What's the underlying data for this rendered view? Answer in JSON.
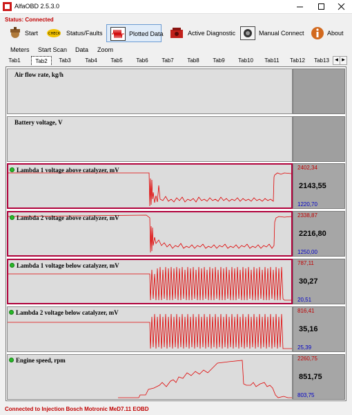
{
  "window": {
    "title": "AlfaOBD 2.5.3.0"
  },
  "status": {
    "text": "Status: Connected"
  },
  "toolbar": {
    "start": "Start",
    "status_faults": "Status/Faults",
    "plotted_data": "Plotted Data",
    "active_diagnostic": "Active Diagnostic",
    "manual_connect": "Manual Connect",
    "about": "About"
  },
  "menu": [
    "Meters",
    "Start Scan",
    "Data",
    "Zoom"
  ],
  "tabs": [
    "Tab1",
    "Tab2",
    "Tab3",
    "Tab4",
    "Tab5",
    "Tab6",
    "Tab7",
    "Tab8",
    "Tab9",
    "Tab10",
    "Tab11",
    "Tab12",
    "Tab13"
  ],
  "active_tab": "Tab2",
  "charts": [
    {
      "title": "Air flow rate, kg/h",
      "active": false,
      "max": "",
      "value": "",
      "min": ""
    },
    {
      "title": "Battery voltage, V",
      "active": false,
      "max": "",
      "value": "",
      "min": ""
    },
    {
      "title": "Lambda 1 voltage above catalyzer, mV",
      "active": true,
      "selected": true,
      "max": "2402,34",
      "value": "2143,55",
      "min": "1220,70"
    },
    {
      "title": "Lambda 2 voltage above catalyzer, mV",
      "active": true,
      "selected": true,
      "max": "2338,87",
      "value": "2216,80",
      "min": "1250,00"
    },
    {
      "title": "Lambda 1 voltage below catalyzer, mV",
      "active": true,
      "selected": true,
      "max": "787,11",
      "value": "30,27",
      "min": "20,51"
    },
    {
      "title": "Lambda 2 voltage below catalyzer, mV",
      "active": true,
      "selected": false,
      "max": "816,41",
      "value": "35,16",
      "min": "25,39"
    },
    {
      "title": "Engine speed, rpm",
      "active": true,
      "selected": false,
      "max": "2260,75",
      "value": "851,75",
      "min": "803,75"
    }
  ],
  "colors": {
    "trace": "#e00000",
    "max_text": "#c00000",
    "min_text": "#0000c8",
    "selected_border": "#b0003a",
    "status_red": "#c00000",
    "indicator": "#26b826"
  },
  "footer": {
    "connection": "Connected to Injection Bosch Motronic MeD7.11 EOBD"
  }
}
